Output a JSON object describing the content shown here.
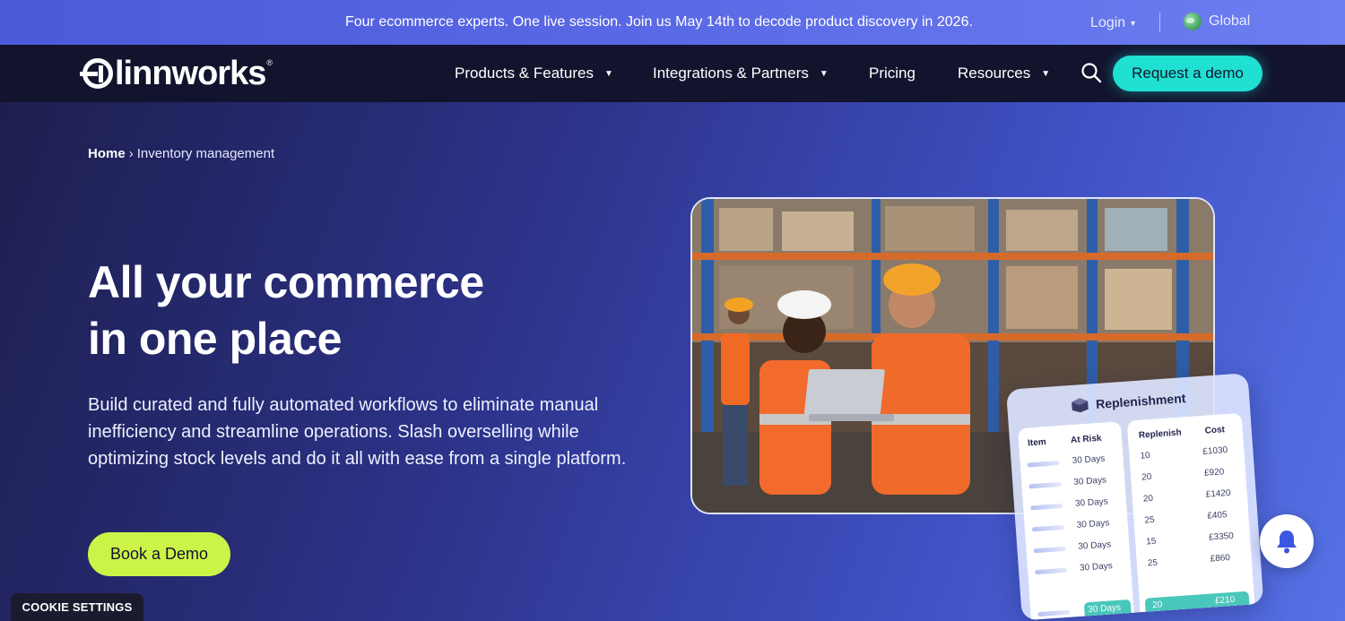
{
  "announcement": {
    "text": "Four ecommerce experts. One live session. Join us May 14th to decode product discovery in 2026.",
    "login_label": "Login",
    "global_label": "Global"
  },
  "nav": {
    "logo_text": "linnworks",
    "items": [
      {
        "label": "Products & Features",
        "has_dropdown": true
      },
      {
        "label": "Integrations & Partners",
        "has_dropdown": true
      },
      {
        "label": "Pricing",
        "has_dropdown": false
      },
      {
        "label": "Resources",
        "has_dropdown": true
      }
    ],
    "demo_label": "Request a demo"
  },
  "breadcrumb": {
    "home": "Home",
    "separator": "›",
    "current": "Inventory management"
  },
  "hero": {
    "title_line1": "All your commerce",
    "title_line2": "in one place",
    "description": "Build curated and fully automated workflows to eliminate manual inefficiency and streamline operations. Slash overselling while optimizing stock levels and do it all with ease from a single platform.",
    "cta_label": "Book a Demo"
  },
  "replenishment": {
    "title": "Replenishment",
    "headers": {
      "item": "Item",
      "at_risk": "At Risk",
      "replenish": "Replenish",
      "cost": "Cost"
    },
    "rows": [
      {
        "at_risk": "30 Days",
        "replenish": "10",
        "cost": "£1030"
      },
      {
        "at_risk": "30 Days",
        "replenish": "20",
        "cost": "£920"
      },
      {
        "at_risk": "30 Days",
        "replenish": "20",
        "cost": "£1420"
      },
      {
        "at_risk": "30 Days",
        "replenish": "25",
        "cost": "£405"
      },
      {
        "at_risk": "30 Days",
        "replenish": "15",
        "cost": "£3350"
      },
      {
        "at_risk": "30 Days",
        "replenish": "25",
        "cost": "£860"
      },
      {
        "at_risk": "30 Days",
        "replenish": "20",
        "cost": "£210"
      }
    ]
  },
  "cookie": {
    "label": "COOKIE SETTINGS"
  },
  "colors": {
    "accent_teal": "#1fe0d1",
    "accent_lime": "#ccf347",
    "nav_bg": "#12142e",
    "highlight_row": "#49c7bb"
  },
  "icons": [
    "globe-icon",
    "search-icon",
    "box-icon",
    "bell-icon",
    "chevron-down-icon"
  ]
}
